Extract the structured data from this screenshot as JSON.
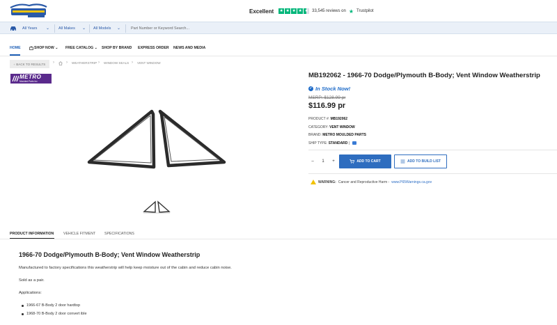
{
  "header": {
    "trustpilot": {
      "rating_word": "Excellent",
      "reviews": "33,545 reviews on",
      "brand": "Trustpilot"
    }
  },
  "search": {
    "year": "All Years",
    "make": "All Makes",
    "model": "All Models",
    "placeholder": "Part Number or Keyword Search..."
  },
  "nav": {
    "home": "HOME",
    "shop_now": "SHOP NOW",
    "free_catalog": "FREE CATALOG",
    "shop_by_brand": "SHOP BY BRAND",
    "express_order": "EXPRESS ORDER",
    "news_media": "NEWS AND MEDIA"
  },
  "breadcrumb": {
    "back": "BACK TO RESULTS",
    "items": [
      "WEATHERSTRIP",
      "WINDOW SEALS",
      "VENT WINDOW"
    ]
  },
  "brand_logo": {
    "line1": "METRO",
    "line2": "Moulded Parts Inc"
  },
  "product": {
    "title": "MB192062 - 1966-70 Dodge/Plymouth B-Body; Vent Window Weatherstrip",
    "stock": "In Stock Now!",
    "msrp": "MSRP: $128.99 pr",
    "price": "$116.99 pr",
    "product_no_label": "PRODUCT #:",
    "product_no": "MB192062",
    "category_label": "CATEGORY:",
    "category": "VENT WINDOW",
    "brand_label": "BRAND:",
    "brand": "METRO MOULDED PARTS",
    "ship_label": "SHIP TYPE:",
    "ship": "STANDARD",
    "ship_sep": "|",
    "qty_minus": "–",
    "qty": "1",
    "qty_plus": "+",
    "add_to_cart": "ADD TO CART",
    "add_to_build": "ADD TO BUILD LIST"
  },
  "warning": {
    "label": "WARNING:",
    "text": "Cancer and Reproductive Harm -",
    "link": "www.P65Warnings.ca.gov"
  },
  "tabs": [
    "PRODUCT INFORMATION",
    "VEHICLE FITMENT",
    "SPECIFICATIONS"
  ],
  "description": {
    "title": "1966-70 Dodge/Plymouth B-Body; Vent Window Weatherstrip",
    "p1": "Manufactured to factory specifications this weatherstrip will help keep moisture out of the cabin and reduce cabin noise.",
    "p2": "Sold as a pair.",
    "p3": "Applications:",
    "items": [
      "1966-67 B-Body 2 door hardtop",
      "1968-70 B-Body 2 door convert ible"
    ]
  },
  "colors": {
    "accent": "#1e5fb6",
    "button": "#2e6dbf",
    "trustpilot": "#00b67a",
    "brand_purple": "#5a2a8c"
  }
}
